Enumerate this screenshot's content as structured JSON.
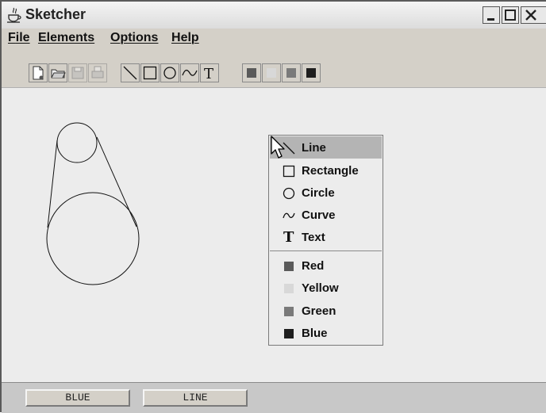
{
  "window": {
    "title": "Sketcher",
    "app_icon": "java-cup-icon"
  },
  "title_buttons": [
    "minimize-icon",
    "maximize-icon",
    "close-icon"
  ],
  "menubar": {
    "items": [
      "File",
      "Elements",
      "Options",
      "Help"
    ]
  },
  "toolbar": {
    "file_tools": [
      "new-file-icon",
      "open-file-icon",
      "save-icon",
      "print-icon"
    ],
    "element_tools": [
      "line-icon",
      "rectangle-icon",
      "circle-icon",
      "curve-icon",
      "text-icon"
    ],
    "color_tools": [
      {
        "name": "red",
        "color": "#5a5a5a"
      },
      {
        "name": "yellow",
        "color": "#d8d8d8"
      },
      {
        "name": "green",
        "color": "#7a7a7a"
      },
      {
        "name": "blue",
        "color": "#1e1e1e"
      }
    ]
  },
  "popup": {
    "element_items": [
      {
        "label": "Line",
        "icon": "line-icon",
        "selected": true
      },
      {
        "label": "Rectangle",
        "icon": "rectangle-icon"
      },
      {
        "label": "Circle",
        "icon": "circle-icon"
      },
      {
        "label": "Curve",
        "icon": "curve-icon"
      },
      {
        "label": "Text",
        "icon": "text-icon"
      }
    ],
    "color_items": [
      {
        "label": "Red",
        "color": "#5a5a5a"
      },
      {
        "label": "Yellow",
        "color": "#d8d8d8"
      },
      {
        "label": "Green",
        "color": "#7a7a7a"
      },
      {
        "label": "Blue",
        "color": "#1e1e1e"
      }
    ]
  },
  "statusbar": {
    "color": "BLUE",
    "type": "LINE"
  }
}
